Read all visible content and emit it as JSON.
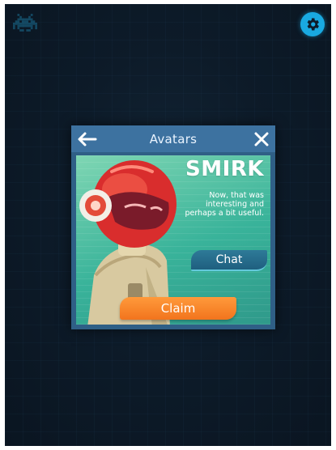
{
  "top_bar": {
    "left_icon": "space-invader-icon",
    "right_icon": "settings-gear-icon",
    "accent": "#19a9e1"
  },
  "modal": {
    "title": "Avatars",
    "back_icon": "back-arrow-icon",
    "close_icon": "close-icon",
    "avatar": {
      "name": "SMIRK",
      "description": "Now, that was interesting and perhaps a bit useful."
    },
    "chat_label": "Chat",
    "claim_label": "Claim",
    "colors": {
      "header": "#3d72a0",
      "card": "#39b39a",
      "claim": "#f2741d",
      "chat": "#1f5f7f"
    }
  }
}
